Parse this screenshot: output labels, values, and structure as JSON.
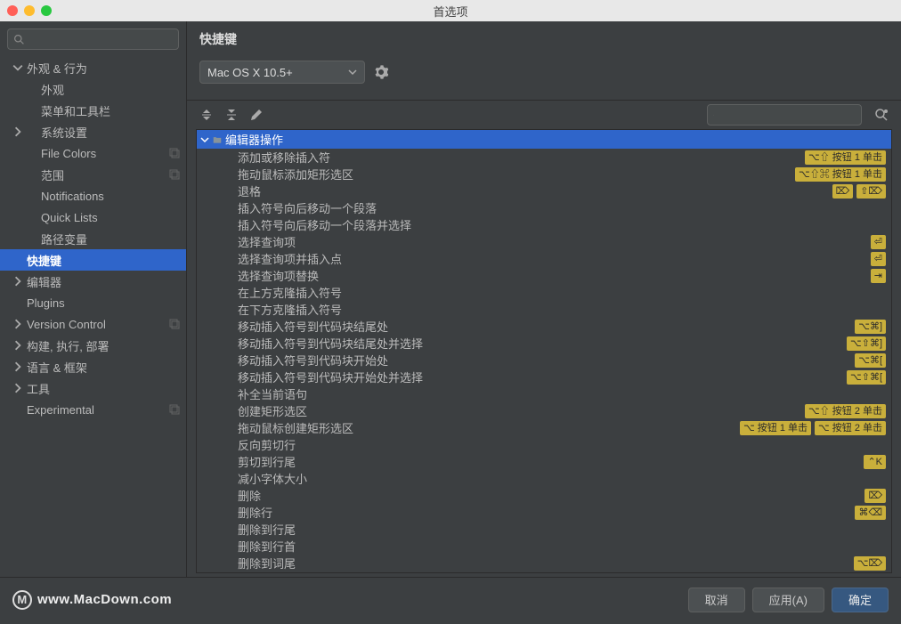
{
  "window": {
    "title": "首选项"
  },
  "search": {
    "placeholder": ""
  },
  "sidebar": [
    {
      "label": "外观 & 行为",
      "depth": 0,
      "arrow": "down",
      "icon": ""
    },
    {
      "label": "外观",
      "depth": 1,
      "arrow": "",
      "icon": ""
    },
    {
      "label": "菜单和工具栏",
      "depth": 1,
      "arrow": "",
      "icon": ""
    },
    {
      "label": "系统设置",
      "depth": 1,
      "arrow": "right",
      "icon": ""
    },
    {
      "label": "File Colors",
      "depth": 1,
      "arrow": "",
      "icon": "copy"
    },
    {
      "label": "范围",
      "depth": 1,
      "arrow": "",
      "icon": "copy"
    },
    {
      "label": "Notifications",
      "depth": 1,
      "arrow": "",
      "icon": ""
    },
    {
      "label": "Quick Lists",
      "depth": 1,
      "arrow": "",
      "icon": ""
    },
    {
      "label": "路径变量",
      "depth": 1,
      "arrow": "",
      "icon": ""
    },
    {
      "label": "快捷键",
      "depth": 0,
      "arrow": "",
      "icon": "",
      "sel": true
    },
    {
      "label": "编辑器",
      "depth": 0,
      "arrow": "right",
      "icon": ""
    },
    {
      "label": "Plugins",
      "depth": 0,
      "arrow": "",
      "icon": ""
    },
    {
      "label": "Version Control",
      "depth": 0,
      "arrow": "right",
      "icon": "copy"
    },
    {
      "label": "构建, 执行, 部署",
      "depth": 0,
      "arrow": "right",
      "icon": ""
    },
    {
      "label": "语言 & 框架",
      "depth": 0,
      "arrow": "right",
      "icon": ""
    },
    {
      "label": "工具",
      "depth": 0,
      "arrow": "right",
      "icon": ""
    },
    {
      "label": "Experimental",
      "depth": 0,
      "arrow": "",
      "icon": "copy"
    }
  ],
  "content": {
    "title": "快捷键",
    "keymap": "Mac OS X 10.5+",
    "group_title": "编辑器操作",
    "actions": [
      {
        "label": "添加或移除插入符",
        "sc": [
          "⌥⇧ 按钮 1 单击"
        ]
      },
      {
        "label": "拖动鼠标添加矩形选区",
        "sc": [
          "⌥⇧⌘ 按钮 1 单击"
        ]
      },
      {
        "label": "退格",
        "sc": [
          "⌦",
          "⇧⌦"
        ]
      },
      {
        "label": "插入符号向后移动一个段落",
        "sc": []
      },
      {
        "label": "插入符号向后移动一个段落并选择",
        "sc": []
      },
      {
        "label": "选择查询项",
        "sc": [
          "⏎"
        ]
      },
      {
        "label": "选择查询项并插入点",
        "sc": [
          "⏎"
        ]
      },
      {
        "label": "选择查询项替换",
        "sc": [
          "⇥"
        ]
      },
      {
        "label": "在上方克隆插入符号",
        "sc": []
      },
      {
        "label": "在下方克隆插入符号",
        "sc": []
      },
      {
        "label": "移动插入符号到代码块结尾处",
        "sc": [
          "⌥⌘]"
        ]
      },
      {
        "label": "移动插入符号到代码块结尾处并选择",
        "sc": [
          "⌥⇧⌘]"
        ]
      },
      {
        "label": "移动插入符号到代码块开始处",
        "sc": [
          "⌥⌘["
        ]
      },
      {
        "label": "移动插入符号到代码块开始处并选择",
        "sc": [
          "⌥⇧⌘["
        ]
      },
      {
        "label": "补全当前语句",
        "sc": []
      },
      {
        "label": "创建矩形选区",
        "sc": [
          "⌥⇧ 按钮 2 单击"
        ]
      },
      {
        "label": "拖动鼠标创建矩形选区",
        "sc": [
          "⌥ 按钮 1 单击",
          "⌥ 按钮 2 单击"
        ]
      },
      {
        "label": "反向剪切行",
        "sc": []
      },
      {
        "label": "剪切到行尾",
        "sc": [
          "⌃K"
        ]
      },
      {
        "label": "减小字体大小",
        "sc": []
      },
      {
        "label": "删除",
        "sc": [
          "⌦"
        ]
      },
      {
        "label": "删除行",
        "sc": [
          "⌘⌫"
        ]
      },
      {
        "label": "删除到行尾",
        "sc": []
      },
      {
        "label": "删除到行首",
        "sc": []
      },
      {
        "label": "删除到词尾",
        "sc": [
          "⌥⌦"
        ]
      }
    ]
  },
  "footer": {
    "watermark": "www.MacDown.com",
    "cancel": "取消",
    "apply": "应用(A)",
    "ok": "确定"
  }
}
